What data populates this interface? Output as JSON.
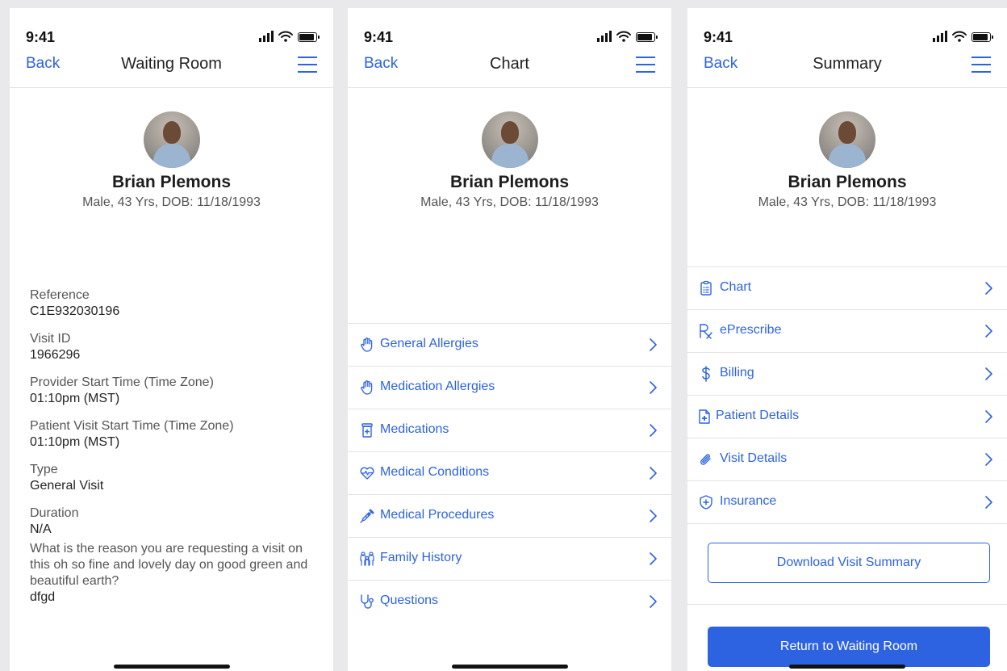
{
  "colors": {
    "accent": "#2d63e0",
    "divider": "#e3e3e6",
    "background": "#e9e9ec"
  },
  "status_bar": {
    "time": "9:41"
  },
  "patient": {
    "name": "Brian Plemons",
    "info": "Male, 43 Yrs, DOB: 11/18/1993"
  },
  "screens": [
    {
      "back": "Back",
      "title": "Waiting Room",
      "fields": [
        {
          "label": "Reference",
          "value": "C1E932030196"
        },
        {
          "label": "Visit ID",
          "value": "1966296"
        },
        {
          "label": "Provider Start Time (Time Zone)",
          "value": "01:10pm (MST)"
        },
        {
          "label": "Patient Visit Start Time (Time Zone)",
          "value": "01:10pm (MST)"
        },
        {
          "label": "Type",
          "value": "General Visit"
        },
        {
          "label": "Duration",
          "value": "N/A"
        }
      ],
      "question": "What is the reason you are requesting a visit on this oh so fine and lovely day on good green and beautiful earth?",
      "answer": "dfgd"
    },
    {
      "back": "Back",
      "title": "Chart",
      "items": [
        {
          "label": "General Allergies",
          "icon": "hand-icon"
        },
        {
          "label": "Medication Allergies",
          "icon": "hand-icon"
        },
        {
          "label": "Medications",
          "icon": "pill-bottle-icon"
        },
        {
          "label": "Medical Conditions",
          "icon": "heart-pulse-icon"
        },
        {
          "label": "Medical Procedures",
          "icon": "syringe-icon"
        },
        {
          "label": "Family History",
          "icon": "family-icon"
        },
        {
          "label": "Questions",
          "icon": "stethoscope-icon"
        }
      ]
    },
    {
      "back": "Back",
      "title": "Summary",
      "items": [
        {
          "label": "Chart",
          "icon": "clipboard-icon"
        },
        {
          "label": "ePrescribe",
          "icon": "rx-icon"
        },
        {
          "label": "Billing",
          "icon": "dollar-icon"
        },
        {
          "label": "Patient Details",
          "icon": "medical-file-icon"
        },
        {
          "label": "Visit Details",
          "icon": "paperclip-icon"
        },
        {
          "label": "Insurance",
          "icon": "shield-plus-icon"
        }
      ],
      "download_button": "Download Visit Summary",
      "return_button": "Return to Waiting Room"
    }
  ]
}
